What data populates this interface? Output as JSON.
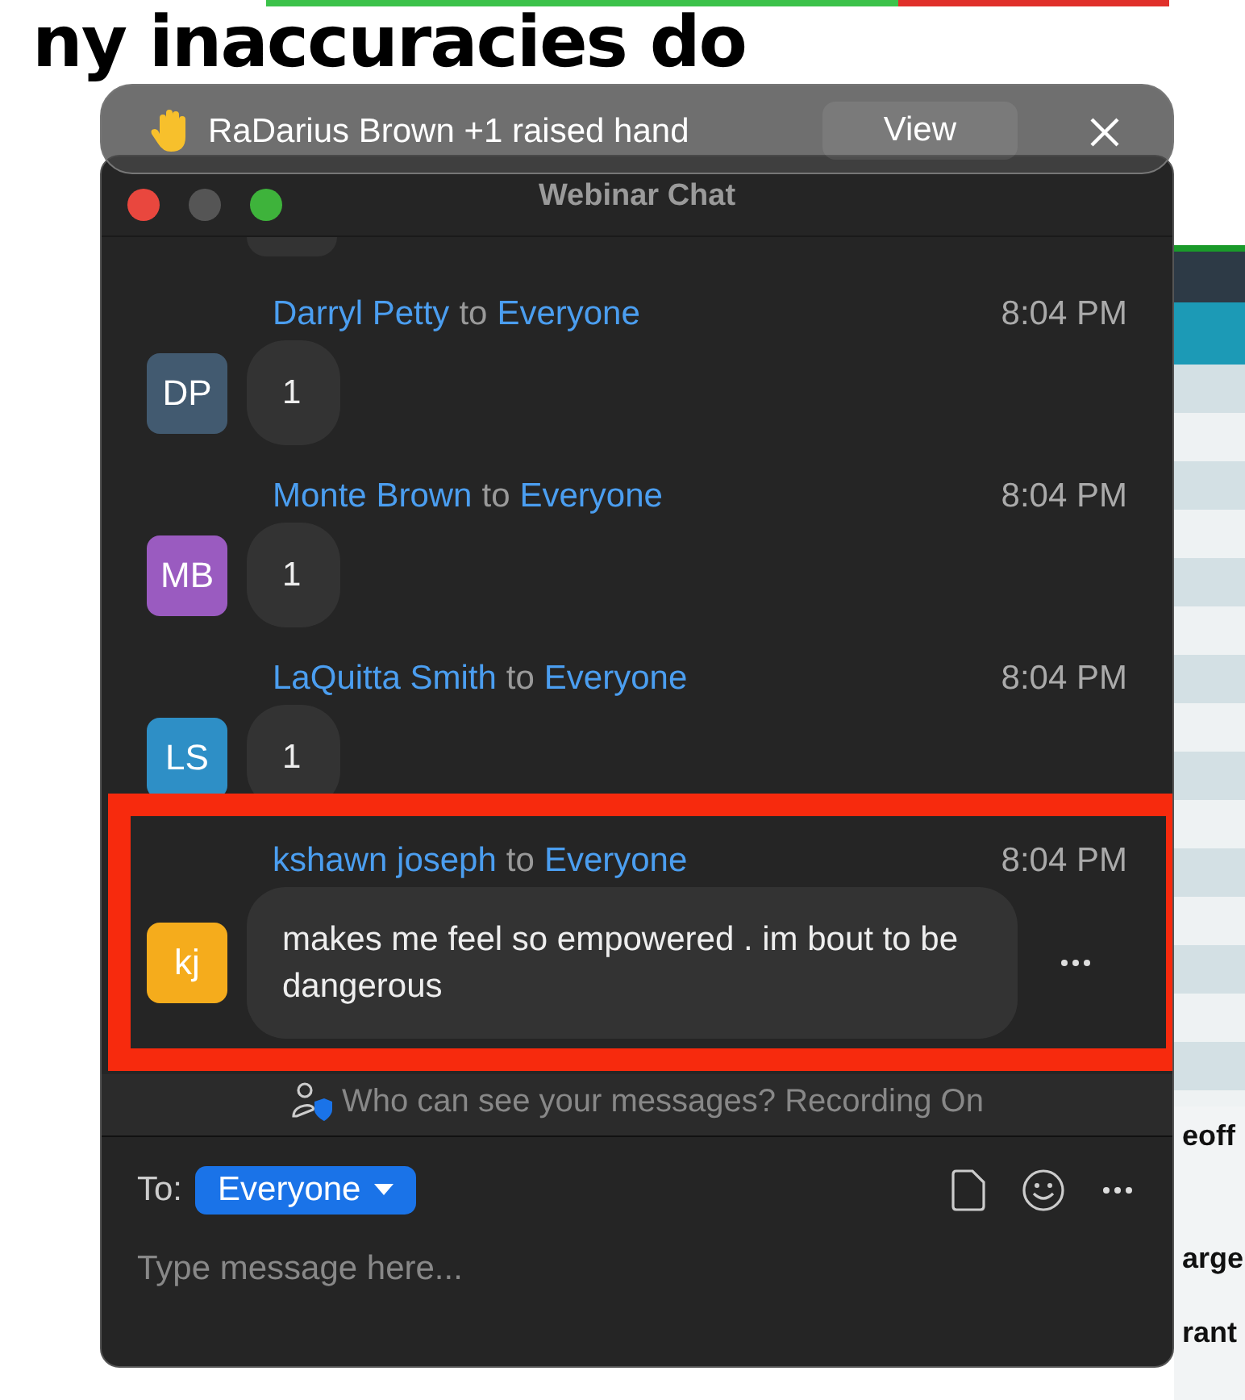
{
  "slide": {
    "progress": {
      "level": 0.7
    },
    "heading": "ny inaccuracies do",
    "side_texts": [
      "eoff",
      "arge",
      "rant"
    ]
  },
  "notification": {
    "text": "RaDarius Brown +1 raised hand",
    "button": "View"
  },
  "window": {
    "title": "Webinar Chat"
  },
  "messages": [
    {
      "sender": "Darryl Petty",
      "connector": "to",
      "recipient": "Everyone",
      "time": "8:04 PM",
      "initials": "DP",
      "color": "#425a70",
      "text": "1",
      "highlighted": false,
      "hovered": false
    },
    {
      "sender": "Monte Brown",
      "connector": "to",
      "recipient": "Everyone",
      "time": "8:04 PM",
      "initials": "MB",
      "color": "#9a5bc0",
      "text": "1",
      "highlighted": false,
      "hovered": false
    },
    {
      "sender": "LaQuitta Smith",
      "connector": "to",
      "recipient": "Everyone",
      "time": "8:04 PM",
      "initials": "LS",
      "color": "#2e8fc6",
      "text": "1",
      "highlighted": false,
      "hovered": false
    },
    {
      "sender": "kshawn joseph",
      "connector": "to",
      "recipient": "Everyone",
      "time": "8:04 PM",
      "initials": "kj",
      "color": "#f5ac1c",
      "text": "makes me feel so empowered . im bout to be dangerous",
      "highlighted": true,
      "hovered": true
    }
  ],
  "privacy_note": "Who can see your messages? Recording On",
  "composer": {
    "to_label": "To:",
    "recipient": "Everyone",
    "placeholder": "Type message here..."
  }
}
